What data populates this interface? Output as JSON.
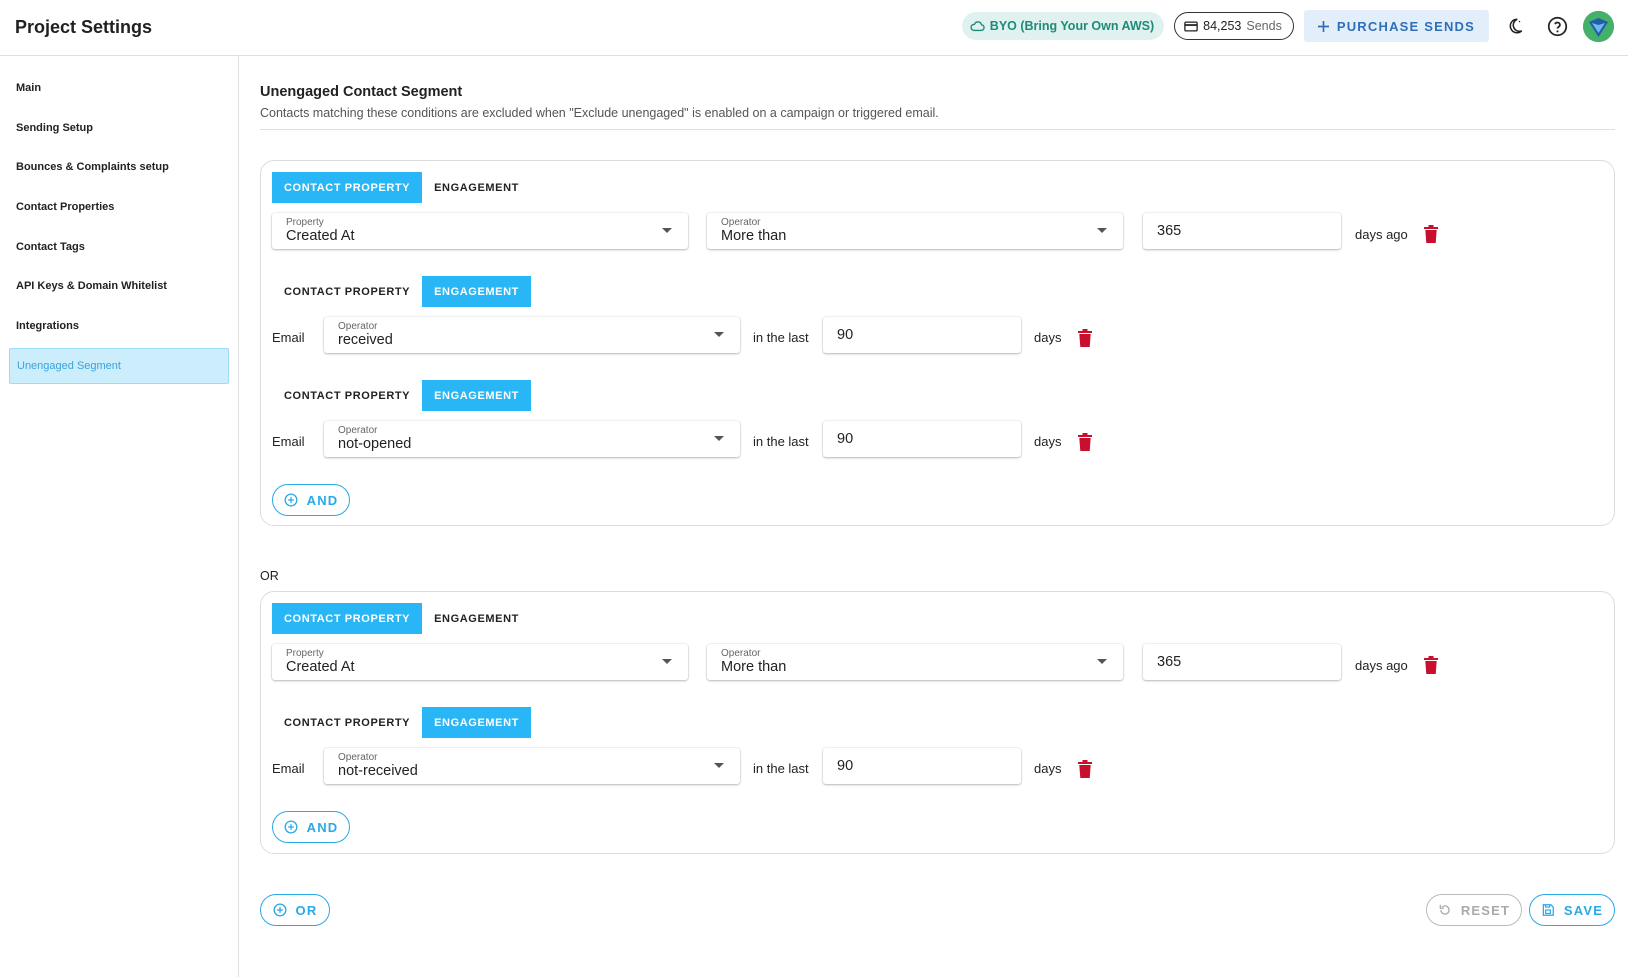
{
  "header": {
    "title": "Project Settings",
    "byo_label": "BYO (Bring Your Own AWS)",
    "sends_count": "84,253",
    "sends_unit": "Sends",
    "purchase_label": "PURCHASE SENDS"
  },
  "sidebar": {
    "items": [
      {
        "label": "Main"
      },
      {
        "label": "Sending Setup"
      },
      {
        "label": "Bounces & Complaints setup"
      },
      {
        "label": "Contact Properties"
      },
      {
        "label": "Contact Tags"
      },
      {
        "label": "API Keys & Domain Whitelist"
      },
      {
        "label": "Integrations"
      },
      {
        "label": "Unengaged Segment"
      }
    ]
  },
  "section": {
    "title": "Unengaged Contact Segment",
    "description": "Contacts matching these conditions are excluded when \"Exclude unengaged\" is enabled on a campaign or triggered email."
  },
  "labels": {
    "tab_property": "CONTACT PROPERTY",
    "tab_engagement": "ENGAGEMENT",
    "property_label": "Property",
    "operator_label": "Operator",
    "email_label": "Email",
    "in_the_last": "in the last",
    "days": "days",
    "days_ago": "days ago",
    "and_button": "AND",
    "or_separator": "OR",
    "or_button": "OR",
    "reset_button": "RESET",
    "save_button": "SAVE"
  },
  "groups": [
    {
      "conditions": [
        {
          "type": "property",
          "property": "Created At",
          "operator": "More than",
          "value": "365"
        },
        {
          "type": "engagement",
          "operator": "received",
          "value": "90"
        },
        {
          "type": "engagement",
          "operator": "not-opened",
          "value": "90"
        }
      ]
    },
    {
      "conditions": [
        {
          "type": "property",
          "property": "Created At",
          "operator": "More than",
          "value": "365"
        },
        {
          "type": "engagement",
          "operator": "not-received",
          "value": "90"
        }
      ]
    }
  ],
  "colors": {
    "accent": "#29b6f6",
    "delete": "#c8102e",
    "byo_text": "#1e8a7a",
    "purchase_text": "#2f6fb8"
  }
}
